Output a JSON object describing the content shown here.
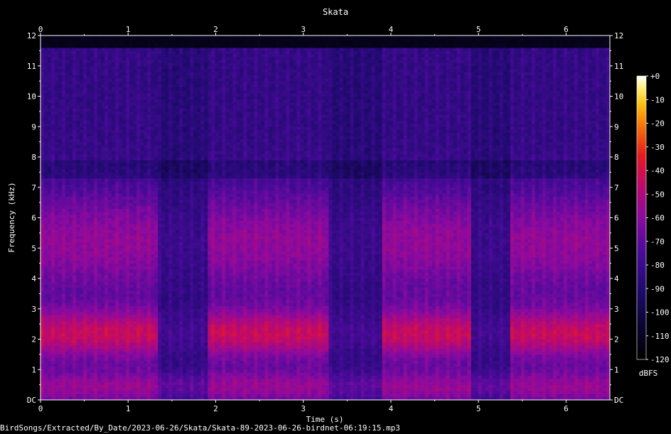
{
  "chart_data": {
    "type": "heatmap",
    "title": "Skata",
    "xlabel": "Time (s)",
    "ylabel": "Frequency (kHz)",
    "x_ticks": [
      0,
      1,
      2,
      3,
      4,
      5,
      6
    ],
    "y_ticks": [
      "DC",
      "1",
      "2",
      "3",
      "4",
      "5",
      "6",
      "7",
      "8",
      "9",
      "10",
      "11",
      "12"
    ],
    "xlim": [
      0,
      6.5
    ],
    "ylim": [
      0,
      12
    ],
    "colorbar": {
      "label": "dBFS",
      "ticks": [
        "+0",
        "-10",
        "-20",
        "-30",
        "-40",
        "-50",
        "-60",
        "-70",
        "-80",
        "-90",
        "-100",
        "-110",
        "-120"
      ],
      "range": [
        -120,
        0
      ]
    },
    "energy_segments_s": [
      [
        0.0,
        1.35
      ],
      [
        1.9,
        3.3
      ],
      [
        3.9,
        5.35
      ],
      [
        5.35,
        6.5
      ]
    ],
    "quiet_gaps_s": [
      [
        1.35,
        1.9
      ],
      [
        3.3,
        3.9
      ],
      [
        4.9,
        5.35
      ]
    ],
    "dominant_band_khz": [
      1.5,
      3.0
    ],
    "secondary_band_khz": [
      4.5,
      6.5
    ]
  },
  "footer": {
    "path": "BirdSongs/Extracted/By_Date/2023-06-26/Skata/Skata-89-2023-06-26-birdnet-06:19:15.mp3"
  }
}
